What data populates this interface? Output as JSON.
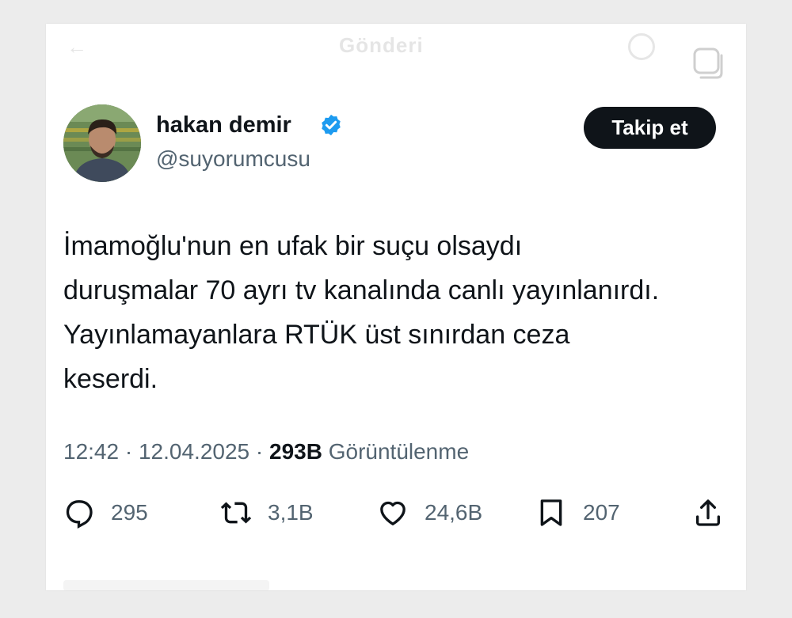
{
  "header": {
    "title": "Gönderi",
    "back_icon": "arrow-left-icon",
    "grok_icon": "grok-icon"
  },
  "overlay": {
    "copy_icon": "copy-icon"
  },
  "tweet": {
    "author_name": "hakan demir",
    "verified_icon": "verified-badge-icon",
    "handle": "@suyorumcusu",
    "follow_label": "Takip et",
    "text_lines": [
      "İmamoğlu'nun en ufak bir suçu olsaydı",
      "duruşmalar 70 ayrı tv kanalında canlı yayınlanırdı.",
      "Yayınlamayanlara RTÜK üst sınırdan ceza",
      "keserdi."
    ],
    "time": "12:42",
    "separator": "·",
    "date": "12.04.2025",
    "views_count": "293B",
    "views_label": "Görüntülenme"
  },
  "actions": {
    "replies": {
      "icon": "reply-icon",
      "count": "295"
    },
    "retweets": {
      "icon": "retweet-icon",
      "count": "3,1B"
    },
    "likes": {
      "icon": "heart-icon",
      "count": "24,6B"
    },
    "bookmarks": {
      "icon": "bookmark-icon",
      "count": "207"
    },
    "share": {
      "icon": "share-icon"
    }
  },
  "colors": {
    "text": "#0f1419",
    "secondary": "#536471",
    "verified": "#1d9bf0",
    "button_bg": "#0f1419",
    "page_bg": "#ececec"
  }
}
